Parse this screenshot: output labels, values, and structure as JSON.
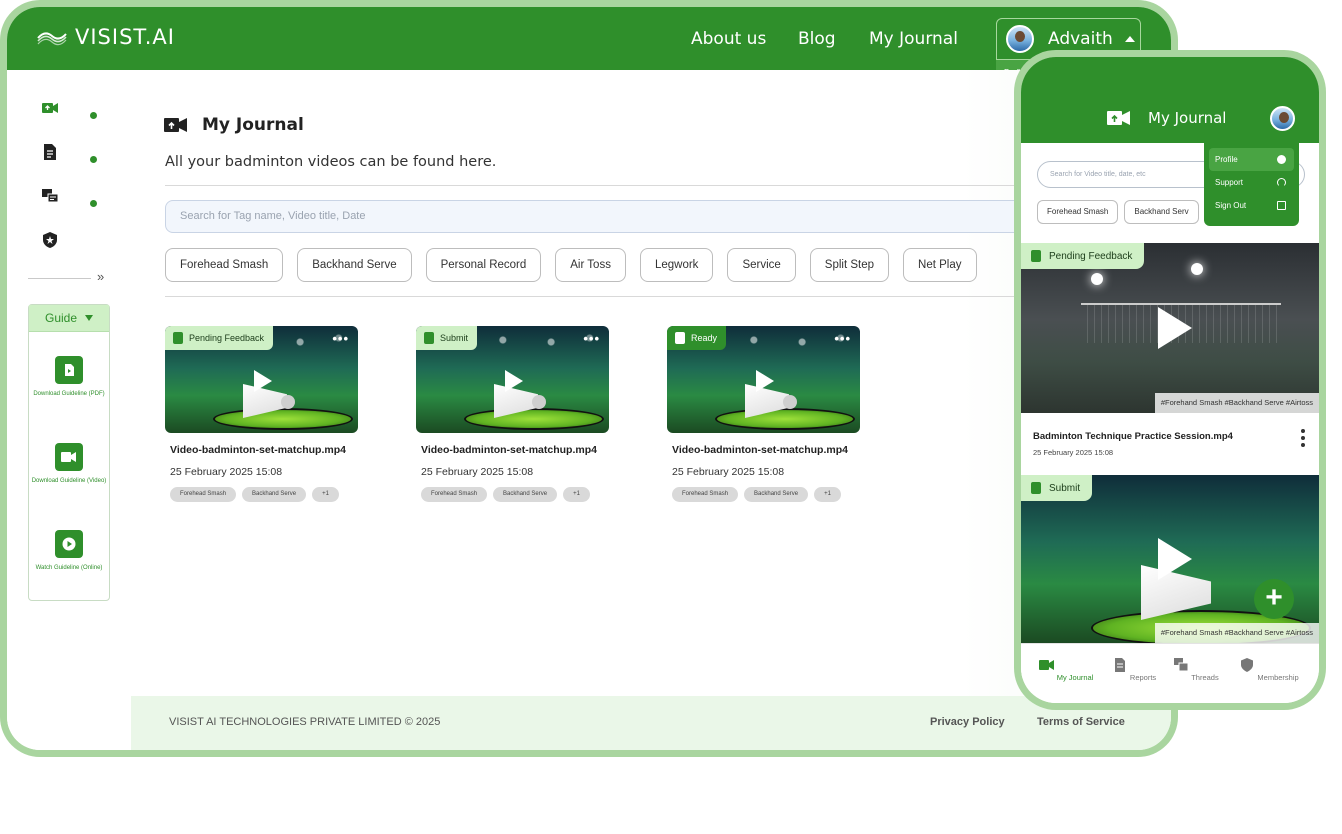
{
  "brand": {
    "logo_text": "VISIST.AI"
  },
  "nav": {
    "about": "About us",
    "blog": "Blog",
    "journal": "My Journal"
  },
  "user": {
    "name": "Advaith",
    "menu_partial": [
      "Profi",
      "Su",
      "Si"
    ]
  },
  "colors": {
    "brand_green": "#2f8f2b",
    "light_green": "#cff0c6",
    "frame_green": "#a9d59f"
  },
  "sidebar": {
    "icons": [
      "upload-video-icon",
      "document-icon",
      "chat-icon",
      "shield-icon"
    ],
    "expand_glyph": "»",
    "guide": {
      "title": "Guide",
      "items": [
        {
          "label": "Download Guideline (PDF)",
          "icon": "download-pdf-icon"
        },
        {
          "label": "Download Guideline (Video)",
          "icon": "download-video-icon"
        },
        {
          "label": "Watch Guideline (Online)",
          "icon": "play-circle-icon"
        }
      ]
    }
  },
  "main": {
    "title": "My Journal",
    "subtitle": "All your badminton videos can be found here.",
    "search_placeholder": "Search for Tag name, Video title, Date",
    "filters": [
      "Forehead Smash",
      "Backhand Serve",
      "Personal Record",
      "Air Toss",
      "Legwork",
      "Service",
      "Split Step",
      "Net Play"
    ],
    "cards": [
      {
        "status": "Pending Feedback",
        "title": "Video-badminton-set-matchup.mp4",
        "date": "25 February 2025 15:08",
        "tags": [
          "Forehead Smash",
          "Backhand Serve",
          "+1"
        ]
      },
      {
        "status": "Submit",
        "title": "Video-badminton-set-matchup.mp4",
        "date": "25 February 2025 15:08",
        "tags": [
          "Forehead Smash",
          "Backhand Serve",
          "+1"
        ]
      },
      {
        "status": "Ready",
        "title": "Video-badminton-set-matchup.mp4",
        "date": "25 February 2025 15:08",
        "tags": [
          "Forehead Smash",
          "Backhand Serve",
          "+1"
        ]
      }
    ],
    "more_glyph": "•••"
  },
  "footer": {
    "copyright": "VISIST AI TECHNOLOGIES PRIVATE LIMITED © 2025",
    "privacy": "Privacy Policy",
    "terms": "Terms of Service"
  },
  "phone": {
    "title": "My Journal",
    "search_placeholder": "Search for Video title, date, etc",
    "chips": [
      "Forehead Smash",
      "Backhand Serv"
    ],
    "menu": [
      {
        "label": "Profile",
        "icon": "user-icon"
      },
      {
        "label": "Support",
        "icon": "headset-icon"
      },
      {
        "label": "Sign Out",
        "icon": "sign-out-icon"
      }
    ],
    "video1": {
      "status": "Pending Feedback",
      "hashtags": "#Forehand Smash  #Backhand Serve  #Airtoss",
      "title": "Badminton Technique Practice Session.mp4",
      "date": "25 February 2025 15:08"
    },
    "video2": {
      "status": "Submit",
      "hashtags": "#Forehand Smash  #Backhand Serve  #Airtoss"
    },
    "fab_glyph": "+",
    "tabs": [
      {
        "label": "My Journal",
        "icon": "video-camera-icon",
        "active": true
      },
      {
        "label": "Reports",
        "icon": "report-icon",
        "active": false
      },
      {
        "label": "Threads",
        "icon": "chat-icon",
        "active": false
      },
      {
        "label": "Membership",
        "icon": "shield-icon",
        "active": false
      }
    ]
  }
}
